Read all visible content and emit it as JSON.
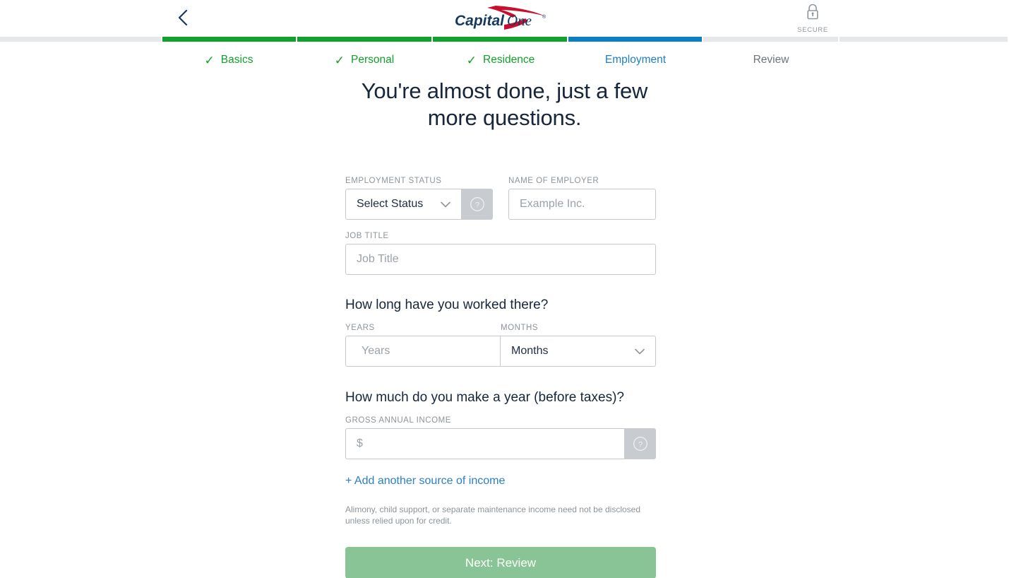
{
  "header": {
    "back_icon": "chevron-left-icon",
    "brand": "CapitalOne",
    "brand_mark": "capital-one-swoosh-logo",
    "secure_label": "SECURE",
    "secure_icon": "lock-icon"
  },
  "progress": {
    "segments": [
      {
        "state": "done",
        "color": "#12a02c"
      },
      {
        "state": "done",
        "color": "#12a02c"
      },
      {
        "state": "done",
        "color": "#12a02c"
      },
      {
        "state": "active",
        "color": "#0b7fc4"
      },
      {
        "state": "todo",
        "color": "#e6e7e8"
      }
    ],
    "steps": [
      {
        "label": "Basics",
        "state": "done",
        "check": "✓"
      },
      {
        "label": "Personal",
        "state": "done",
        "check": "✓"
      },
      {
        "label": "Residence",
        "state": "done",
        "check": "✓"
      },
      {
        "label": "Employment",
        "state": "active",
        "check": ""
      },
      {
        "label": "Review",
        "state": "todo",
        "check": ""
      }
    ]
  },
  "main": {
    "headline_line1": "You're almost done, just a few",
    "headline_line2": "more questions.",
    "employment_status_label": "EMPLOYMENT STATUS",
    "employment_status_value": "Select Status",
    "employment_status_help_icon": "question-mark-icon",
    "employer_label": "NAME OF EMPLOYER",
    "employer_placeholder": "Example Inc.",
    "job_title_label": "JOB TITLE",
    "job_title_placeholder": "Job Title",
    "duration_question": "How long have you worked there?",
    "years_label": "YEARS",
    "years_placeholder": "Years",
    "months_label": "MONTHS",
    "months_value": "Months",
    "income_question": "How much do you make a year (before taxes)?",
    "income_label": "GROSS ANNUAL INCOME",
    "income_placeholder": "$",
    "income_help_icon": "question-mark-icon",
    "add_income_link": "+ Add another source of income",
    "disclaimer": "Alimony, child support, or separate maintenance income need not be disclosed unless relied upon for credit.",
    "next_button": "Next: Review"
  },
  "colors": {
    "green": "#12a02c",
    "blue": "#0b7fc4",
    "link_blue": "#2b7fc4",
    "button_green": "#88c495",
    "text_dark": "#17263a",
    "label_gray": "#8c949a",
    "border_gray": "#c6cace",
    "brand_red": "#c8102e",
    "brand_navy": "#13395e"
  }
}
